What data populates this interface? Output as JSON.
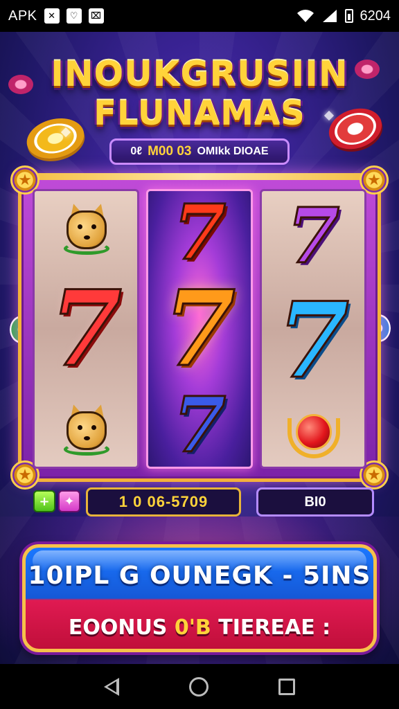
{
  "status_bar": {
    "left_label": "APK",
    "icons": [
      "app-icon-1",
      "app-icon-2",
      "app-icon-3"
    ],
    "right_icons": [
      "wifi-icon",
      "signal-icon",
      "battery-icon"
    ],
    "time": "6204"
  },
  "game": {
    "title_line1": "INOUKGRUSIIN",
    "title_line2": "FLUNAMAS",
    "subtitle_prefix": "0ℓ",
    "subtitle_gold": "M00 03",
    "subtitle_suffix": "OMIkk DIOAE",
    "reels": [
      [
        "fox-symbol",
        "red-seven",
        "fox-symbol"
      ],
      [
        "red-seven",
        "orange-seven",
        "blue-seven"
      ],
      [
        "purple-seven",
        "cyan-seven",
        "red-bell-symbol"
      ]
    ],
    "seven_glyph": "7",
    "credit_value": "1 0 06-5709",
    "bet_value": "BI0",
    "cta_line1": "10IPL G OUNEGK - 5INS",
    "cta_line2_prefix": "EOONUS",
    "cta_line2_gold": "0'B",
    "cta_line2_suffix": "TIEREAE :",
    "colors": {
      "accent_gold": "#ffd33a",
      "frame_purple": "#c04bd8",
      "cta_blue": "#1a77ff",
      "cta_red": "#e01a52"
    }
  },
  "nav_bar": {
    "icons": [
      "back-icon",
      "home-icon",
      "recents-icon"
    ]
  }
}
